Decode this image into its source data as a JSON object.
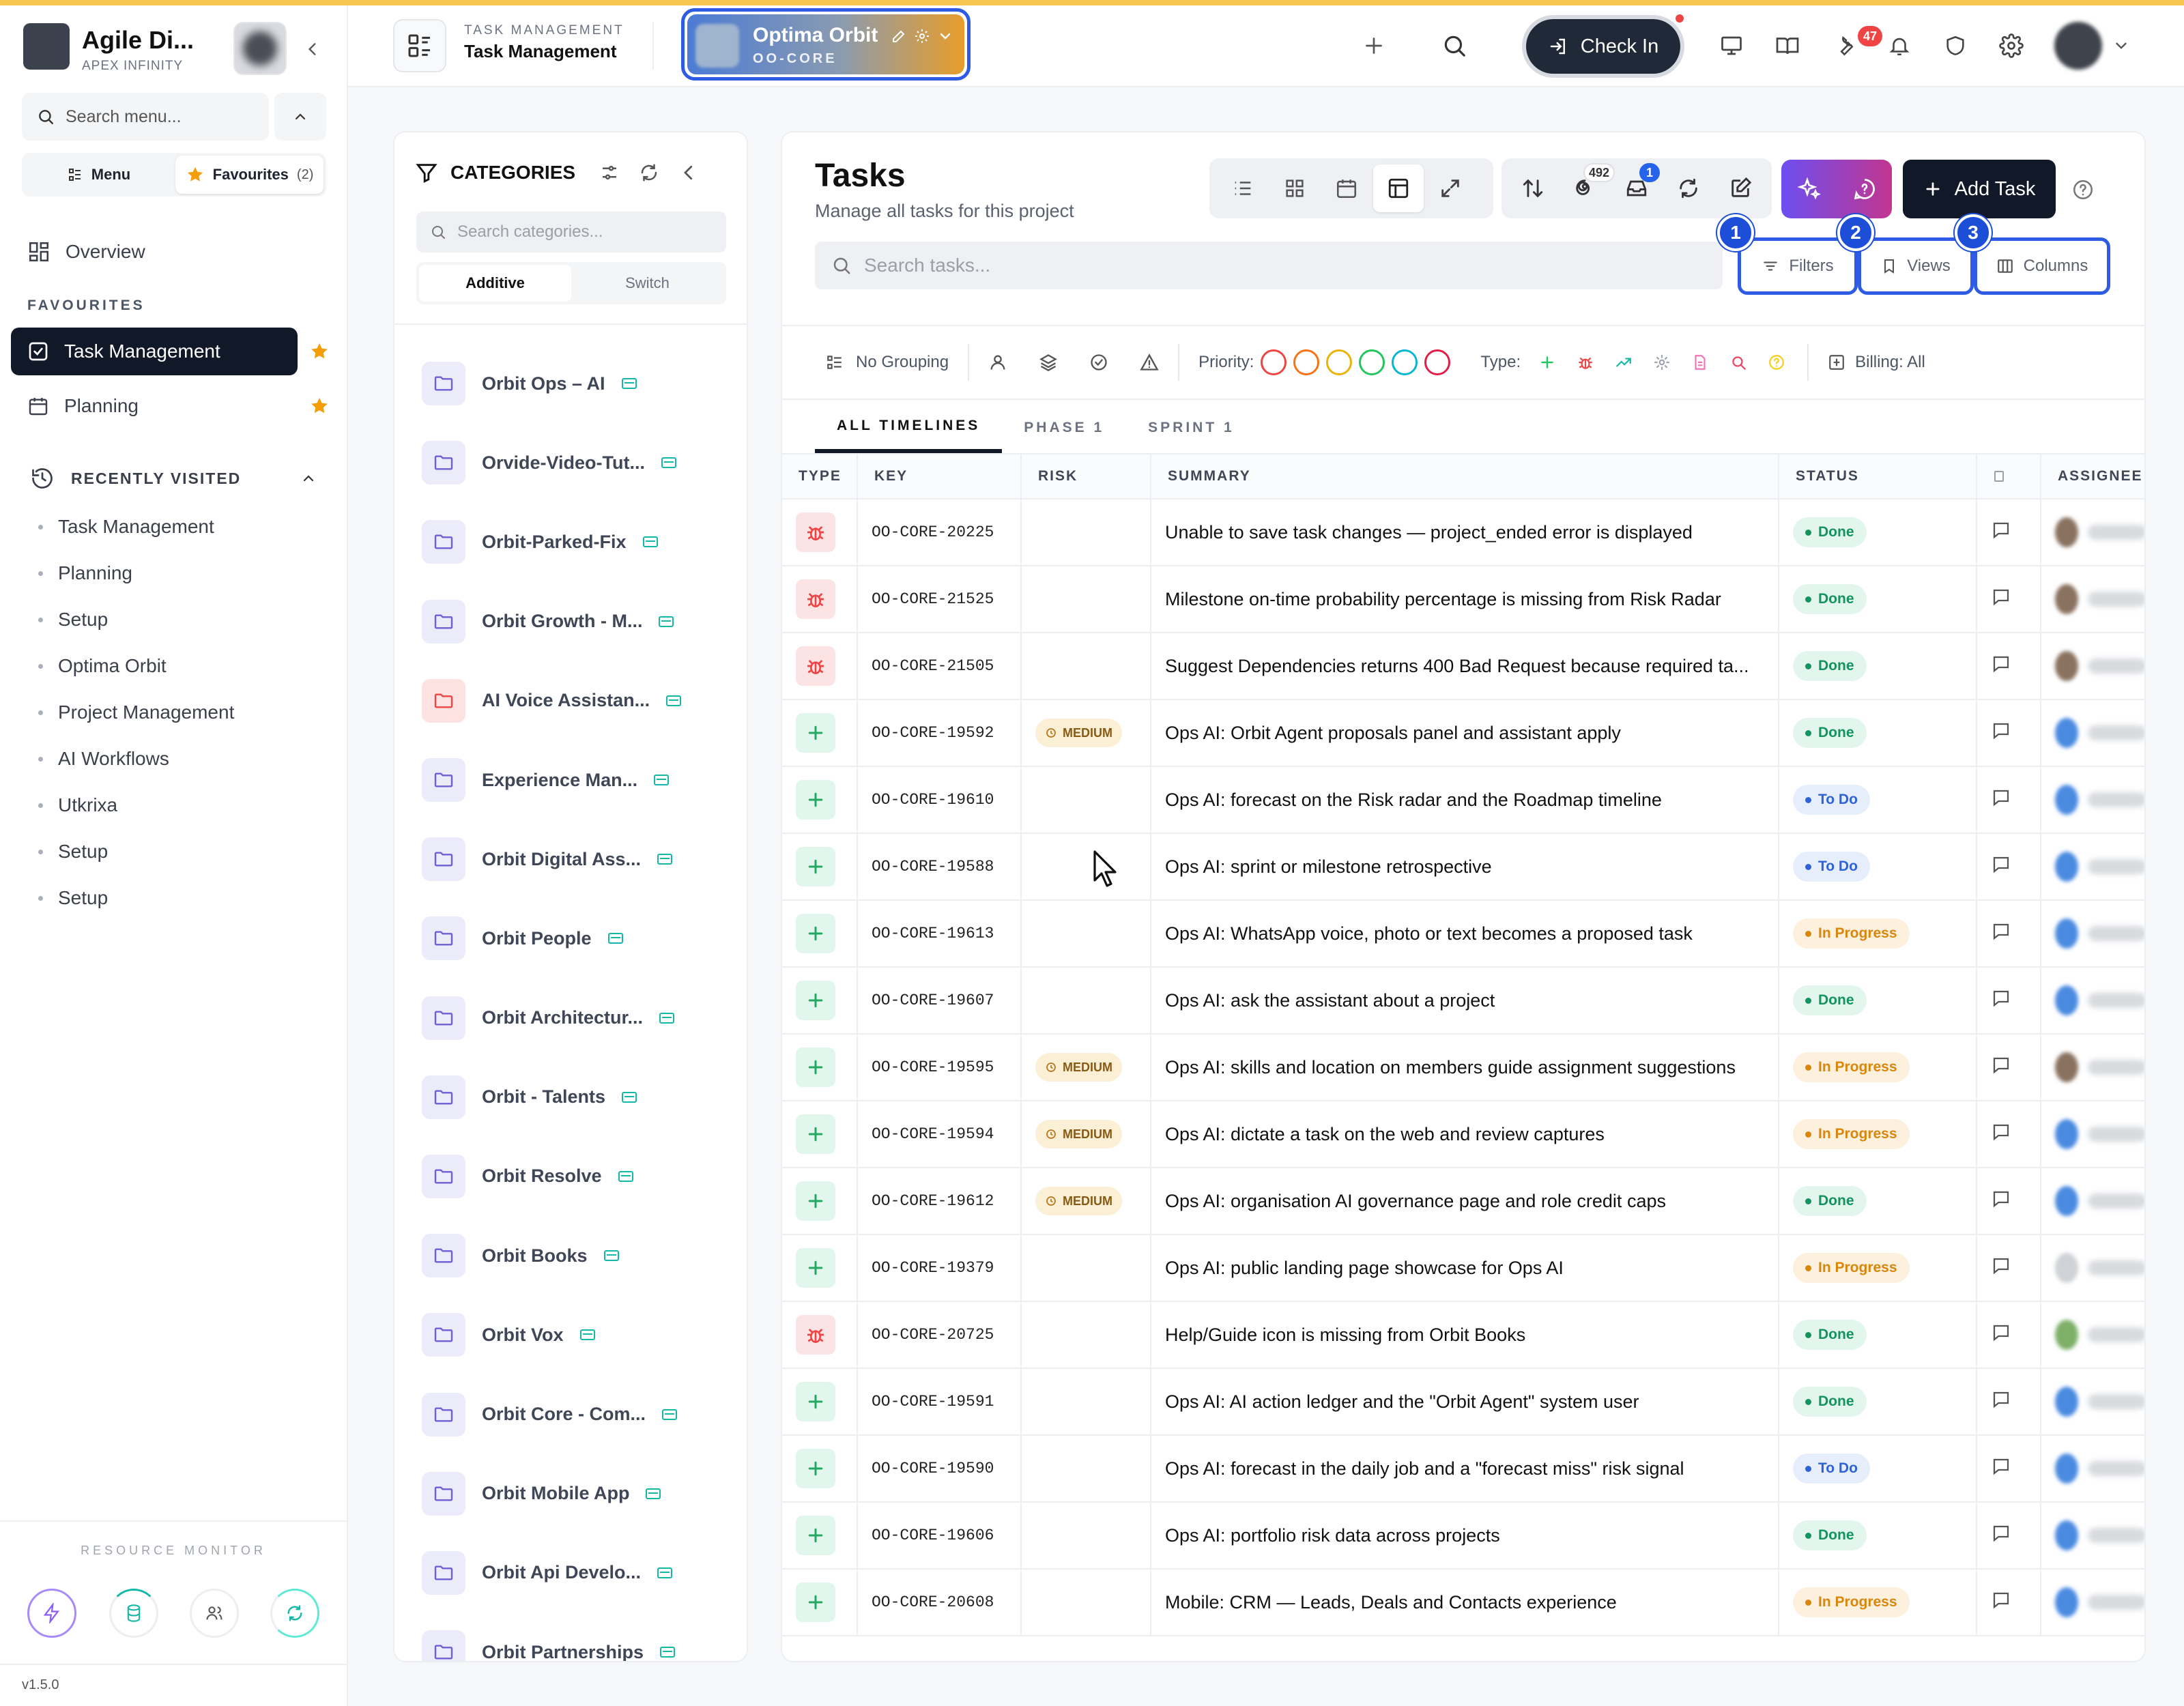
{
  "sidebar": {
    "org_name": "Agile Di...",
    "org_sub": "APEX INFINITY",
    "search_placeholder": "Search menu...",
    "tab_menu": "Menu",
    "tab_favourites": "Favourites",
    "favourites_count": "(2)",
    "overview": "Overview",
    "favourites_label": "FAVOURITES",
    "fav_items": [
      "Task Management",
      "Planning"
    ],
    "recent_label": "RECENTLY VISITED",
    "recent_items": [
      "Task Management",
      "Planning",
      "Setup",
      "Optima Orbit",
      "Project Management",
      "AI Workflows",
      "Utkrixa",
      "Setup",
      "Setup"
    ],
    "resource_monitor": "RESOURCE MONITOR",
    "version": "v1.5.0"
  },
  "topbar": {
    "section_small": "TASK MANAGEMENT",
    "section_big": "Task Management",
    "project_name": "Optima Orbit",
    "project_code": "OO-CORE",
    "checkin": "Check In",
    "notif_count": "47"
  },
  "categories": {
    "title": "CATEGORIES",
    "search_placeholder": "Search categories...",
    "mode_additive": "Additive",
    "mode_switch": "Switch",
    "items": [
      {
        "name": "Orbit Ops – AI",
        "red": false
      },
      {
        "name": "Orvide-Video-Tut...",
        "red": false
      },
      {
        "name": "Orbit-Parked-Fix",
        "red": false
      },
      {
        "name": "Orbit Growth - M...",
        "red": false
      },
      {
        "name": "AI Voice Assistan...",
        "red": true
      },
      {
        "name": "Experience Man...",
        "red": false
      },
      {
        "name": "Orbit Digital Ass...",
        "red": false
      },
      {
        "name": "Orbit People",
        "red": false
      },
      {
        "name": "Orbit Architectur...",
        "red": false
      },
      {
        "name": "Orbit - Talents",
        "red": false
      },
      {
        "name": "Orbit Resolve",
        "red": false
      },
      {
        "name": "Orbit Books",
        "red": false
      },
      {
        "name": "Orbit Vox",
        "red": false
      },
      {
        "name": "Orbit Core - Com...",
        "red": false
      },
      {
        "name": "Orbit Mobile App",
        "red": false
      },
      {
        "name": "Orbit Api Develo...",
        "red": false
      },
      {
        "name": "Orbit Partnerships",
        "red": false
      }
    ]
  },
  "tasks": {
    "title": "Tasks",
    "subtitle": "Manage all tasks for this project",
    "count_badge": "492",
    "inbox_badge": "1",
    "add_task": "Add Task",
    "search_placeholder": "Search tasks...",
    "filters": "Filters",
    "views": "Views",
    "columns": "Columns",
    "hl_numbers": [
      "1",
      "2",
      "3"
    ],
    "grouping": "No Grouping",
    "priority_label": "Priority:",
    "type_label": "Type:",
    "billing": "Billing: All",
    "priority_colors": [
      "#ef4444",
      "#f97316",
      "#eab308",
      "#22c55e",
      "#06b6d4",
      "#e11d48"
    ],
    "timeline_tabs": [
      "ALL TIMELINES",
      "PHASE 1",
      "SPRINT 1"
    ],
    "columns_head": [
      "TYPE",
      "KEY",
      "RISK",
      "SUMMARY",
      "STATUS",
      "",
      "ASSIGNEE"
    ],
    "rows": [
      {
        "type": "bug",
        "key": "OO-CORE-20225",
        "risk": "",
        "summary": "Unable to save task changes — project_ended error is displayed",
        "status": "Done",
        "av": "#8a7260"
      },
      {
        "type": "bug",
        "key": "OO-CORE-21525",
        "risk": "",
        "summary": "Milestone on-time probability percentage is missing from Risk Radar",
        "status": "Done",
        "av": "#8a7260"
      },
      {
        "type": "bug",
        "key": "OO-CORE-21505",
        "risk": "",
        "summary": "Suggest Dependencies returns 400 Bad Request because required ta...",
        "status": "Done",
        "av": "#8a7260"
      },
      {
        "type": "story",
        "key": "OO-CORE-19592",
        "risk": "MEDIUM",
        "summary": "Ops AI: Orbit Agent proposals panel and assistant apply",
        "status": "Done",
        "av": "#4a8be0"
      },
      {
        "type": "story",
        "key": "OO-CORE-19610",
        "risk": "",
        "summary": "Ops AI: forecast on the Risk radar and the Roadmap timeline",
        "status": "To Do",
        "av": "#4a8be0"
      },
      {
        "type": "story",
        "key": "OO-CORE-19588",
        "risk": "",
        "summary": "Ops AI: sprint or milestone retrospective",
        "status": "To Do",
        "av": "#4a8be0"
      },
      {
        "type": "story",
        "key": "OO-CORE-19613",
        "risk": "",
        "summary": "Ops AI: WhatsApp voice, photo or text becomes a proposed task",
        "status": "In Progress",
        "av": "#4a8be0"
      },
      {
        "type": "story",
        "key": "OO-CORE-19607",
        "risk": "",
        "summary": "Ops AI: ask the assistant about a project",
        "status": "Done",
        "av": "#4a8be0"
      },
      {
        "type": "story",
        "key": "OO-CORE-19595",
        "risk": "MEDIUM",
        "summary": "Ops AI: skills and location on members guide assignment suggestions",
        "status": "In Progress",
        "av": "#8a7260"
      },
      {
        "type": "story",
        "key": "OO-CORE-19594",
        "risk": "MEDIUM",
        "summary": "Ops AI: dictate a task on the web and review captures",
        "status": "In Progress",
        "av": "#4a8be0"
      },
      {
        "type": "story",
        "key": "OO-CORE-19612",
        "risk": "MEDIUM",
        "summary": "Ops AI: organisation AI governance page and role credit caps",
        "status": "Done",
        "av": "#4a8be0"
      },
      {
        "type": "story",
        "key": "OO-CORE-19379",
        "risk": "",
        "summary": "Ops AI: public landing page showcase for Ops AI",
        "status": "In Progress",
        "av": "#cfd2d6"
      },
      {
        "type": "bug",
        "key": "OO-CORE-20725",
        "risk": "",
        "summary": "Help/Guide icon is missing from Orbit Books",
        "status": "Done",
        "av": "#7fb069"
      },
      {
        "type": "story",
        "key": "OO-CORE-19591",
        "risk": "",
        "summary": "Ops AI: AI action ledger and the \"Orbit Agent\" system user",
        "status": "Done",
        "av": "#4a8be0"
      },
      {
        "type": "story",
        "key": "OO-CORE-19590",
        "risk": "",
        "summary": "Ops AI: forecast in the daily job and a \"forecast miss\" risk signal",
        "status": "To Do",
        "av": "#4a8be0"
      },
      {
        "type": "story",
        "key": "OO-CORE-19606",
        "risk": "",
        "summary": "Ops AI: portfolio risk data across projects",
        "status": "Done",
        "av": "#4a8be0"
      },
      {
        "type": "story",
        "key": "OO-CORE-20608",
        "risk": "",
        "summary": "Mobile: CRM — Leads, Deals and Contacts experience",
        "status": "In Progress",
        "av": "#4a8be0"
      }
    ]
  },
  "colors": {
    "accent": "#2d5be3",
    "dark": "#111827",
    "done": "#15935e",
    "todo": "#2d63d6",
    "in_progress": "#d9860c"
  }
}
